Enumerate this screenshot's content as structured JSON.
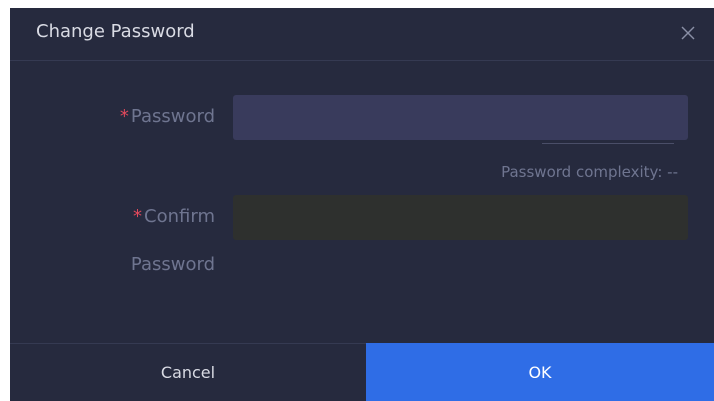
{
  "dialog": {
    "title": "Change Password",
    "close_icon": "close-icon"
  },
  "form": {
    "password": {
      "required_mark": "*",
      "label": "Password",
      "value": ""
    },
    "complexity": {
      "text": "Password complexity: --"
    },
    "confirm": {
      "required_mark": "*",
      "label_line1": "Confirm",
      "label_line2": "Password",
      "value": ""
    }
  },
  "footer": {
    "cancel_label": "Cancel",
    "ok_label": "OK"
  },
  "colors": {
    "dialog_bg": "#262a3e",
    "accent": "#2f6de6",
    "required": "#e2495c",
    "label": "#6f7590",
    "password_input_bg": "#393b5c",
    "confirm_input_bg": "#2e302e"
  }
}
